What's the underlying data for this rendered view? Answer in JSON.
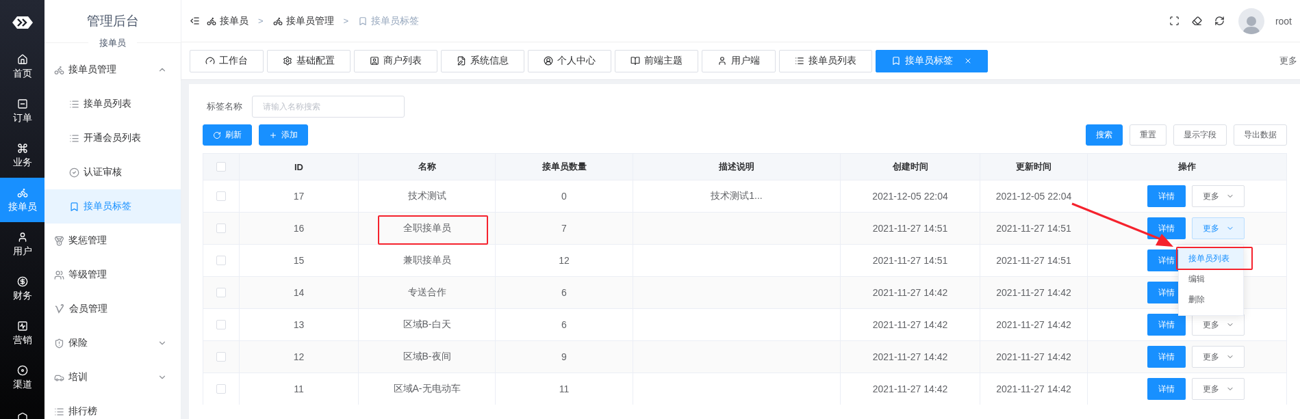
{
  "rail": {
    "items": [
      {
        "label": "首页",
        "selected": false
      },
      {
        "label": "订单",
        "selected": false
      },
      {
        "label": "业务",
        "selected": false
      },
      {
        "label": "接单员",
        "selected": true
      },
      {
        "label": "用户",
        "selected": false
      },
      {
        "label": "财务",
        "selected": false
      },
      {
        "label": "营销",
        "selected": false
      },
      {
        "label": "渠道",
        "selected": false
      }
    ]
  },
  "sidebar": {
    "title": "管理后台",
    "subtitle": "接单员",
    "items": [
      {
        "label": "接单员管理",
        "expanded": true,
        "children": [
          {
            "label": "接单员列表",
            "selected": false
          },
          {
            "label": "开通会员列表",
            "selected": false
          },
          {
            "label": "认证审核",
            "selected": false
          },
          {
            "label": "接单员标签",
            "selected": true
          }
        ]
      },
      {
        "label": "奖惩管理"
      },
      {
        "label": "等级管理"
      },
      {
        "label": "会员管理"
      },
      {
        "label": "保险",
        "expanded": false
      },
      {
        "label": "培训",
        "expanded": false
      },
      {
        "label": "排行榜"
      }
    ]
  },
  "header": {
    "breadcrumb": [
      {
        "label": "接单员",
        "current": false
      },
      {
        "label": "接单员管理",
        "current": false
      },
      {
        "label": "接单员标签",
        "current": true
      }
    ],
    "separator": ">",
    "user": "root"
  },
  "tabs": {
    "items": [
      {
        "label": "工作台",
        "selected": false
      },
      {
        "label": "基础配置",
        "selected": false
      },
      {
        "label": "商户列表",
        "selected": false
      },
      {
        "label": "系统信息",
        "selected": false
      },
      {
        "label": "个人中心",
        "selected": false
      },
      {
        "label": "前端主题",
        "selected": false
      },
      {
        "label": "用户端",
        "selected": false
      },
      {
        "label": "接单员列表",
        "selected": false
      },
      {
        "label": "接单员标签",
        "selected": true
      }
    ],
    "more": "更多"
  },
  "filter": {
    "label": "标签名称",
    "placeholder": "请输入名称搜索"
  },
  "toolbar": {
    "left": [
      "刷新",
      "添加"
    ],
    "right": [
      {
        "label": "搜索",
        "primary": true
      },
      {
        "label": "重置",
        "primary": false
      },
      {
        "label": "显示字段",
        "primary": false
      },
      {
        "label": "导出数据",
        "primary": false
      }
    ]
  },
  "table": {
    "columns": [
      "ID",
      "名称",
      "接单员数量",
      "描述说明",
      "创建时间",
      "更新时间",
      "操作"
    ],
    "header_checked": false,
    "rows": [
      {
        "checked": false,
        "annotated": false,
        "id": "17",
        "name": "技术测试",
        "count": "0",
        "description": "技术测试1...",
        "created": "2021-12-05 22:04",
        "updated": "2021-12-05 22:04",
        "actions": [
          {
            "kind": "primary",
            "label": "详情"
          },
          {
            "kind": "dropdown",
            "label": "更多",
            "open": false
          }
        ]
      },
      {
        "checked": false,
        "annotated": true,
        "id": "16",
        "name": "全职接单员",
        "count": "7",
        "created": "2021-11-27 14:51",
        "updated": "2021-11-27 14:51",
        "actions": [
          {
            "kind": "primary",
            "label": "详情"
          },
          {
            "kind": "dropdown",
            "label": "更多",
            "open": true
          }
        ]
      },
      {
        "checked": false,
        "annotated": false,
        "id": "15",
        "name": "兼职接单员",
        "count": "12",
        "created": "2021-11-27 14:51",
        "updated": "2021-11-27 14:51",
        "actions": [
          {
            "kind": "primary",
            "label": "详情"
          }
        ]
      },
      {
        "checked": false,
        "annotated": false,
        "id": "14",
        "name": "专送合作",
        "count": "6",
        "created": "2021-11-27 14:42",
        "updated": "2021-11-27 14:42",
        "actions": [
          {
            "kind": "primary",
            "label": "详情"
          }
        ]
      },
      {
        "checked": false,
        "annotated": false,
        "id": "13",
        "name": "区域B-白天",
        "count": "6",
        "created": "2021-11-27 14:42",
        "updated": "2021-11-27 14:42",
        "actions": [
          {
            "kind": "primary",
            "label": "详情"
          },
          {
            "kind": "dropdown",
            "label": "更多",
            "open": false
          }
        ]
      },
      {
        "checked": false,
        "annotated": false,
        "id": "12",
        "name": "区域B-夜间",
        "count": "9",
        "created": "2021-11-27 14:42",
        "updated": "2021-11-27 14:42",
        "actions": [
          {
            "kind": "primary",
            "label": "详情"
          },
          {
            "kind": "dropdown",
            "label": "更多",
            "open": false
          }
        ]
      },
      {
        "checked": false,
        "annotated": false,
        "id": "11",
        "name": "区域A-无电动车",
        "count": "11",
        "created": "2021-11-27 14:42",
        "updated": "2021-11-27 14:42",
        "actions": [
          {
            "kind": "primary",
            "label": "详情"
          },
          {
            "kind": "dropdown",
            "label": "更多",
            "open": false
          }
        ]
      }
    ]
  },
  "dropdown": {
    "items": [
      {
        "label": "接单员列表",
        "selected": true,
        "annotated": true
      },
      {
        "label": "编辑",
        "selected": false,
        "annotated": false
      },
      {
        "label": "删除",
        "selected": false,
        "annotated": false
      }
    ]
  }
}
